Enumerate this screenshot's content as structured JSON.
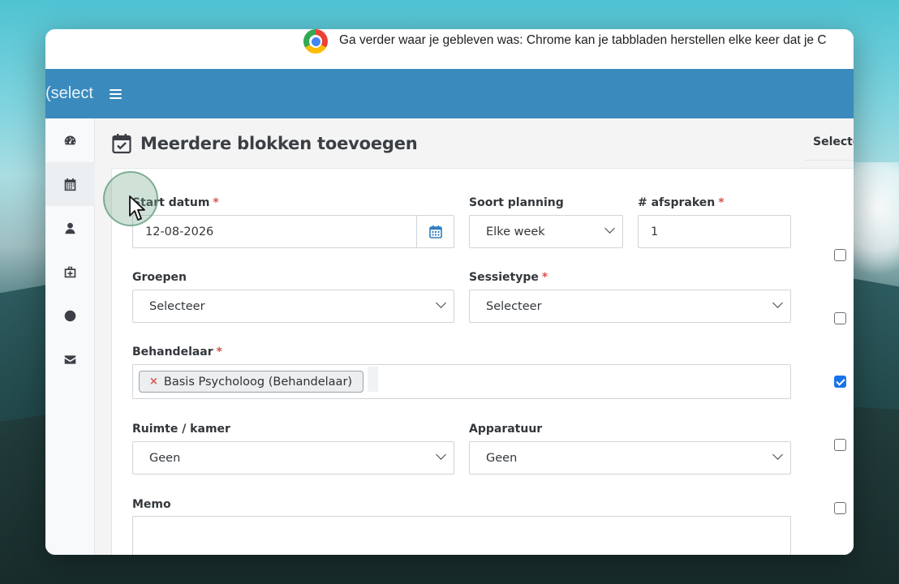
{
  "chrome_notice": {
    "text": "Ga verder waar je gebleven was: Chrome kan je tabbladen herstellen elke keer dat je C"
  },
  "topbar": {
    "brand": "(select",
    "bg_color": "#3a8abd"
  },
  "sidebar": {
    "items": [
      {
        "icon": "dashboard-icon",
        "active": false
      },
      {
        "icon": "calendar-icon",
        "active": true
      },
      {
        "icon": "user-icon",
        "active": false
      },
      {
        "icon": "medical-kit-icon",
        "active": false
      },
      {
        "icon": "globe-icon",
        "active": false
      },
      {
        "icon": "envelope-icon",
        "active": false
      }
    ]
  },
  "page": {
    "title": "Meerdere blokken toevoegen",
    "title_icon": "calendar-check-icon"
  },
  "form": {
    "start_datum": {
      "label": "Start datum",
      "required_mark": "*",
      "value": "12-08-2026"
    },
    "soort_planning": {
      "label": "Soort planning",
      "value": "Elke week"
    },
    "afspraken": {
      "label": "# afspraken",
      "required_mark": "*",
      "value": "1"
    },
    "groepen": {
      "label": "Groepen",
      "value": "Selecteer"
    },
    "sessietype": {
      "label": "Sessietype",
      "required_mark": "*",
      "value": "Selecteer"
    },
    "behandelaar": {
      "label": "Behandelaar",
      "required_mark": "*",
      "tag_remove": "×",
      "tag": "Basis Psycholoog (Behandelaar)"
    },
    "ruimte": {
      "label": "Ruimte / kamer",
      "value": "Geen"
    },
    "apparatuur": {
      "label": "Apparatuur",
      "value": "Geen"
    },
    "memo": {
      "label": "Memo",
      "value": ""
    }
  },
  "right_column": {
    "header": "Selecte",
    "checkboxes": [
      false,
      false,
      true,
      false,
      false
    ]
  }
}
